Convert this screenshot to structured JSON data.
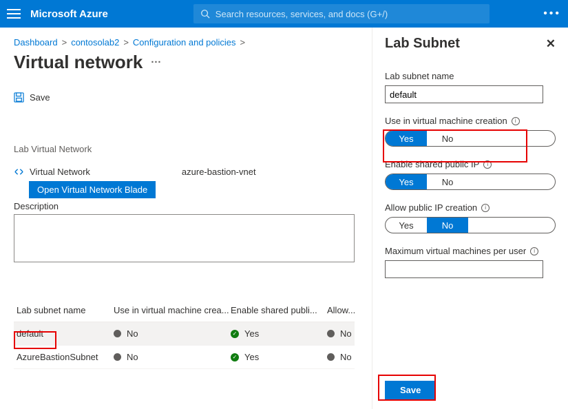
{
  "topbar": {
    "brand": "Microsoft Azure",
    "search_placeholder": "Search resources, services, and docs (G+/)"
  },
  "breadcrumb": {
    "items": [
      "Dashboard",
      "contosolab2",
      "Configuration and policies"
    ],
    "sep": ">"
  },
  "page_title": "Virtual network",
  "save_label": "Save",
  "section_label": "Lab Virtual Network",
  "vnet": {
    "label": "Virtual Network",
    "value": "azure-bastion-vnet",
    "open_button": "Open Virtual Network Blade"
  },
  "description_label": "Description",
  "description_value": "",
  "table": {
    "headers": [
      "Lab subnet name",
      "Use in virtual machine crea...",
      "Enable shared publi...",
      "Allow..."
    ],
    "rows": [
      {
        "name": "default",
        "use": "No",
        "shared": "Yes",
        "allow": "No",
        "use_ok": false,
        "shared_ok": true,
        "allow_ok": false
      },
      {
        "name": "AzureBastionSubnet",
        "use": "No",
        "shared": "Yes",
        "allow": "No",
        "use_ok": false,
        "shared_ok": true,
        "allow_ok": false
      }
    ]
  },
  "panel": {
    "title": "Lab Subnet",
    "fields": {
      "name_label": "Lab subnet name",
      "name_value": "default",
      "use_label": "Use in virtual machine creation",
      "shared_label": "Enable shared public IP",
      "allow_label": "Allow public IP creation",
      "max_label": "Maximum virtual machines per user",
      "max_value": ""
    },
    "toggle": {
      "yes": "Yes",
      "no": "No"
    },
    "save": "Save"
  }
}
